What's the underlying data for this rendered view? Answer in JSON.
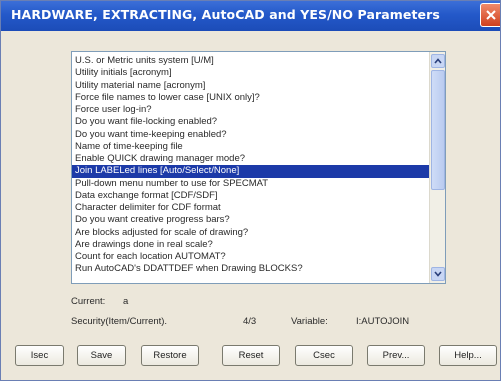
{
  "window": {
    "title": "HARDWARE, EXTRACTING, AutoCAD and YES/NO Parameters"
  },
  "list": {
    "items": [
      "U.S. or Metric units system [U/M]",
      "Utility initials [acronym]",
      "Utility material name [acronym]",
      "Force file names to lower case [UNIX only]?",
      "Force user log-in?",
      "Do you want file-locking enabled?",
      "Do you want time-keeping enabled?",
      "Name of time-keeping file",
      "Enable QUICK drawing manager mode?",
      "Join LABELed lines [Auto/Select/None]",
      "Pull-down menu number to use for SPECMAT",
      "Data exchange format [CDF/SDF]",
      "Character delimiter for CDF format",
      "Do you want creative progress bars?",
      "Are blocks adjusted for scale of drawing?",
      "Are drawings done in real scale?",
      "Count for each location AUTOMAT?",
      "Run AutoCAD's DDATTDEF when Drawing BLOCKS?"
    ],
    "selected_index": 9
  },
  "status": {
    "current_label": "Current:",
    "current_value": "a",
    "security_label": "Security(Item/Current).",
    "security_value": "4/3",
    "variable_label": "Variable:",
    "variable_value": "I:AUTOJOIN"
  },
  "buttons": {
    "isec": "Isec",
    "save": "Save",
    "restore": "Restore",
    "reset": "Reset",
    "csec": "Csec",
    "prev": "Prev...",
    "help": "Help..."
  },
  "colors": {
    "titlebar": "#2459c9",
    "selection": "#1c3aa8",
    "close_button": "#d0401e"
  }
}
